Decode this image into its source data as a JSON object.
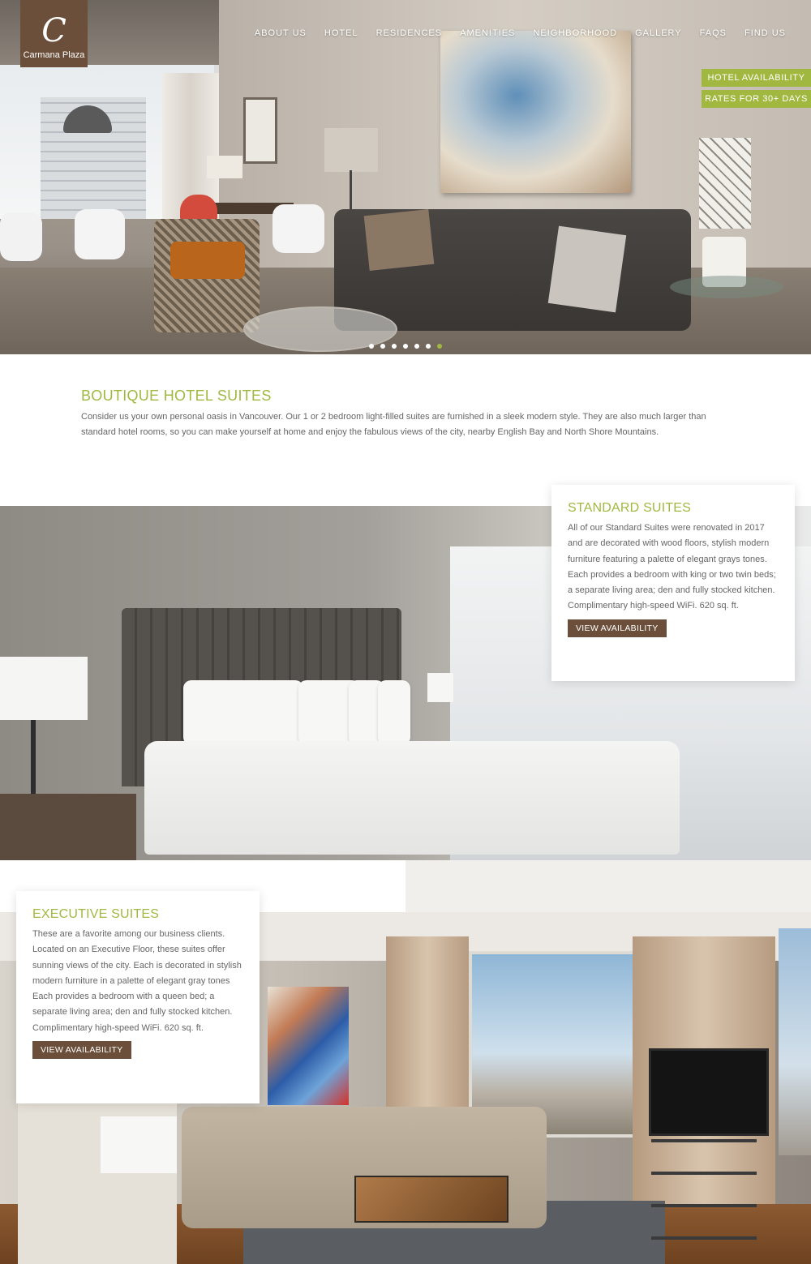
{
  "brand": {
    "monogram": "C",
    "name": "Carmana Plaza",
    "accent": "#a1b840",
    "brown": "#6b4f3a"
  },
  "nav": {
    "items": [
      {
        "label": "ABOUT US"
      },
      {
        "label": "HOTEL"
      },
      {
        "label": "RESIDENCES"
      },
      {
        "label": "AMENITIES"
      },
      {
        "label": "NEIGHBORHOOD"
      },
      {
        "label": "GALLERY"
      },
      {
        "label": "FAQS"
      },
      {
        "label": "FIND US"
      }
    ]
  },
  "cta": {
    "hotel_availability": "HOTEL AVAILABILITY",
    "rates": "RATES FOR 30+ DAYS"
  },
  "slider": {
    "total": 7,
    "active": 7
  },
  "intro": {
    "title": "BOUTIQUE HOTEL SUITES",
    "body": "Consider us your own personal oasis in  Vancouver. Our 1 or 2 bedroom light-filled suites are furnished in a sleek modern style. They are also much larger than standard hotel rooms, so you can make yourself at home and enjoy the fabulous views of the city, nearby English Bay and North Shore Mountains."
  },
  "standard": {
    "title": "STANDARD SUITES",
    "body": "All of our Standard Suites were renovated in 2017 and are decorated with wood floors, stylish modern furniture featuring a palette of elegant grays tones. Each provides a bedroom with king or two twin beds; a separate living area; den and fully stocked kitchen. Complimentary high-speed WiFi. 620 sq. ft.",
    "button": "VIEW AVAILABILITY"
  },
  "executive": {
    "title": "EXECUTIVE SUITES",
    "body": "These are a favorite among our business clients. Located on an Executive Floor, these suites offer sunning views of the city. Each is decorated in stylish modern furniture in a palette of elegant gray tones Each provides a bedroom with a queen bed; a separate living area; den and fully stocked kitchen. Complimentary high-speed WiFi. 620 sq. ft.",
    "button": "VIEW AVAILABILITY"
  }
}
